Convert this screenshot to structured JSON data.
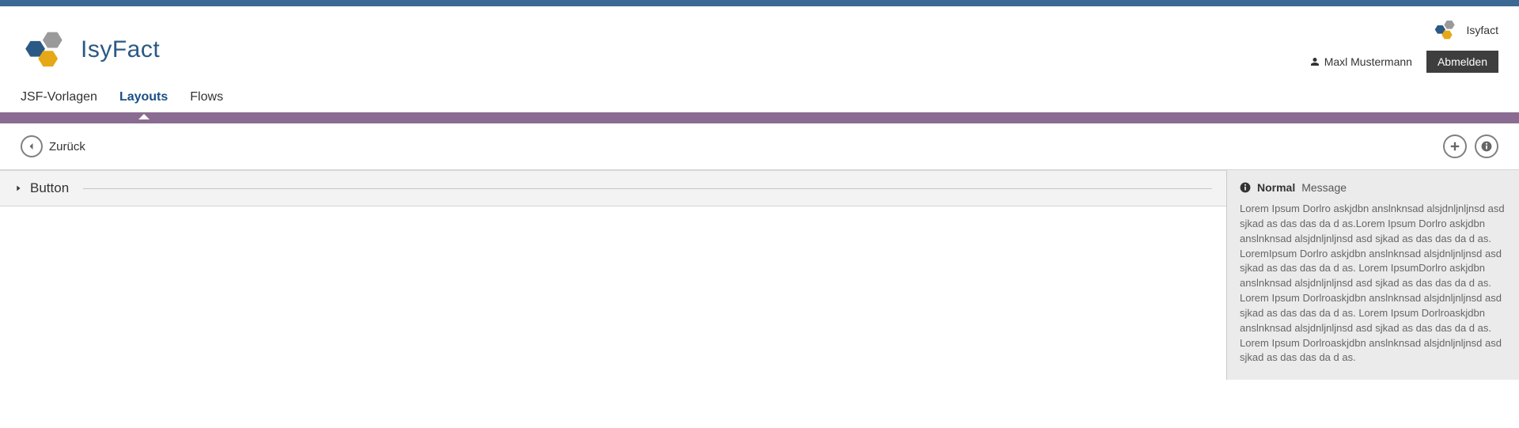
{
  "brand": {
    "name": "IsyFact",
    "small_label": "Isyfact"
  },
  "user": {
    "name": "Maxl Mustermann",
    "logout_label": "Abmelden"
  },
  "nav": {
    "items": [
      {
        "label": "JSF-Vorlagen",
        "active": false
      },
      {
        "label": "Layouts",
        "active": true
      },
      {
        "label": "Flows",
        "active": false
      }
    ]
  },
  "toolbar": {
    "back_label": "Zurück"
  },
  "section": {
    "title": "Button"
  },
  "info_panel": {
    "heading_strong": "Normal",
    "heading_light": "Message",
    "body": "Lorem Ipsum Dorlro askjdbn anslnknsad alsjdnljnljnsd asd sjkad as das das da d as.Lorem Ipsum Dorlro askjdbn anslnknsad alsjdnljnljnsd asd sjkad as das das da d as. LoremIpsum Dorlro askjdbn anslnknsad alsjdnljnljnsd asd sjkad as das das da d as. Lorem IpsumDorlro askjdbn anslnknsad alsjdnljnljnsd asd sjkad as das das da d as. Lorem Ipsum Dorlroaskjdbn anslnknsad alsjdnljnljnsd asd sjkad as das das da d as. Lorem Ipsum Dorlroaskjdbn anslnknsad alsjdnljnljnsd asd sjkad as das das da d as. Lorem Ipsum Dorlroaskjdbn anslnknsad alsjdnljnljnsd asd sjkad as das das da d as."
  }
}
